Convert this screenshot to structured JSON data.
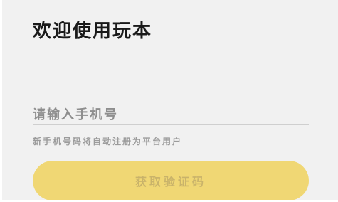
{
  "page": {
    "title": "欢迎使用玩本"
  },
  "login": {
    "phone_placeholder": "请输入手机号",
    "phone_value": "",
    "hint": "新手机号码将自动注册为平台用户",
    "get_code_label": "获取验证码"
  },
  "colors": {
    "background": "#f1f1f1",
    "button": "#f0d774",
    "button_text": "#c9b36a",
    "title": "#1a1a1a"
  }
}
